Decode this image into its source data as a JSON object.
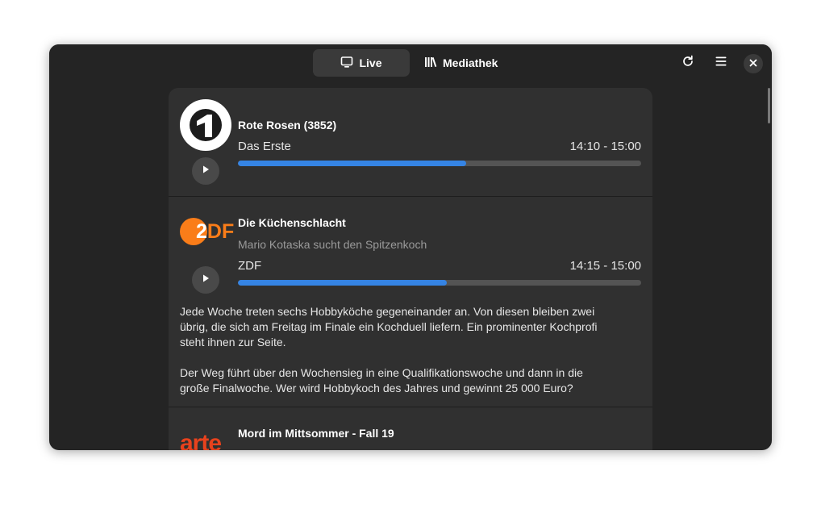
{
  "header": {
    "tabs": [
      {
        "label": "Live",
        "icon": "monitor-icon",
        "active": true
      },
      {
        "label": "Mediathek",
        "icon": "library-icon",
        "active": false
      }
    ],
    "buttons": {
      "refresh": "refresh-icon",
      "menu": "hamburger-menu-icon",
      "close": "close-icon"
    }
  },
  "programs": [
    {
      "title": "Rote Rosen (3852)",
      "channel": "Das Erste",
      "time": "14:10 - 15:00",
      "progress": 0.565,
      "logo": "das-erste-logo"
    },
    {
      "title": "Die Küchenschlacht",
      "subtitle": "Mario Kotaska sucht den Spitzenkoch",
      "channel": "ZDF",
      "time": "14:15 - 15:00",
      "progress": 0.518,
      "logo_text": "ZDF",
      "description": [
        "Jede Woche treten sechs Hobbyköche gegeneinander an. Von diesen bleiben zwei übrig, die sich am Freitag im Finale ein Kochduell liefern. Ein prominenter Kochprofi steht ihnen zur Seite.",
        "Der Weg führt über den Wochensieg in eine Qualifikationswoche und dann in die große Finalwoche. Wer wird Hobbykoch des Jahres und gewinnt 25 000 Euro?"
      ]
    },
    {
      "title": "Mord im Mittsommer - Fall 19",
      "logo_text": "arte"
    }
  ],
  "colors": {
    "accent": "#3584e4",
    "zdf": "#fa7d19",
    "arte": "#e8421d"
  }
}
